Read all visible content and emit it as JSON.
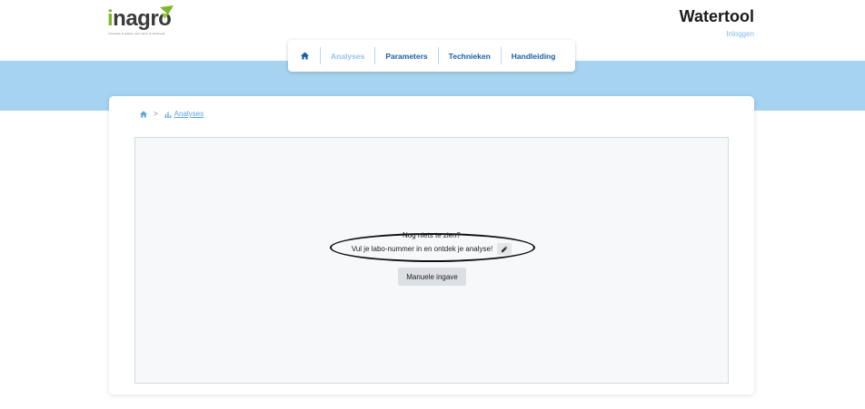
{
  "header": {
    "logo": {
      "text_i": "i",
      "text_rest": "nagro",
      "tagline": "innovatie & advies voor land- & tuinbouw"
    },
    "app_title": "Watertool",
    "login_label": "Inloggen"
  },
  "nav": {
    "items": [
      {
        "label": "",
        "icon": "home-icon"
      },
      {
        "label": "Analyses",
        "active": true
      },
      {
        "label": "Parameters"
      },
      {
        "label": "Technieken"
      },
      {
        "label": "Handleiding"
      }
    ]
  },
  "breadcrumb": {
    "home_icon": "home-icon",
    "separator": ">",
    "current_icon": "chart-icon",
    "current": "Analyses"
  },
  "empty_state": {
    "title": "Nog niets te zien?",
    "message": "Vul je labo-nummer in en ontdek je analyse!",
    "edit_icon": "pencil-icon",
    "manual_button": "Manuele ingave"
  },
  "colors": {
    "band": "#a5d3f0",
    "nav_text": "#1b5fa3",
    "nav_active": "#8fc4e8",
    "link": "#5aa4d8",
    "logo_green": "#7ab829"
  }
}
